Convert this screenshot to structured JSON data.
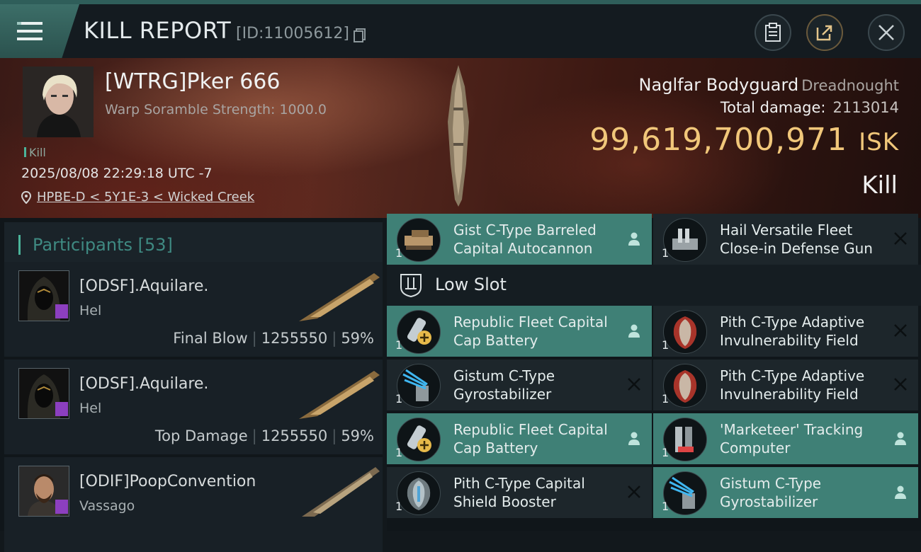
{
  "header": {
    "title": "KILL REPORT",
    "report_id": "[ID:11005612]"
  },
  "victim": {
    "pilot_name": "[WTRG]Pker 666",
    "scramble_strength": "Warp Soramble Strength: 1000.0",
    "kill_tag": "Kill",
    "datetime": "2025/08/08 22:29:18 UTC -7",
    "location": "HPBE-D < 5Y1E-3 < Wicked Creek",
    "ship_name": "Naglfar Bodyguard",
    "ship_class": "Dreadnought",
    "total_damage_label": "Total damage:",
    "total_damage": "2113014",
    "isk_value": "99,619,700,971",
    "isk_unit": "ISK",
    "result": "Kill"
  },
  "participants": {
    "label": "Participants",
    "count": "[53]",
    "items": [
      {
        "name": "[ODSF].Aquilare.",
        "ship": "Hel",
        "role": "Final Blow",
        "damage": "1255550",
        "percent": "59%"
      },
      {
        "name": "[ODSF].Aquilare.",
        "ship": "Hel",
        "role": "Top Damage",
        "damage": "1255550",
        "percent": "59%"
      },
      {
        "name": "[ODIF]PoopConvention",
        "ship": "Vassago",
        "role": "",
        "damage": "",
        "percent": ""
      }
    ]
  },
  "modules": {
    "top_row": [
      {
        "qty": "1",
        "name_l1": "Gist C-Type Barreled",
        "name_l2": "Capital Autocannon",
        "state": "fitted"
      },
      {
        "qty": "1",
        "name_l1": "Hail Versatile Fleet",
        "name_l2": "Close-in Defense Gun",
        "state": "destroyed"
      }
    ],
    "low_slot_label": "Low Slot",
    "low_slot": [
      {
        "qty": "1",
        "name_l1": "Republic Fleet Capital",
        "name_l2": "Cap Battery",
        "state": "fitted"
      },
      {
        "qty": "1",
        "name_l1": "Pith C-Type Adaptive",
        "name_l2": "Invulnerability Field",
        "state": "destroyed"
      },
      {
        "qty": "1",
        "name_l1": "Gistum C-Type",
        "name_l2": "Gyrostabilizer",
        "state": "destroyed"
      },
      {
        "qty": "1",
        "name_l1": "Pith C-Type Adaptive",
        "name_l2": "Invulnerability Field",
        "state": "destroyed"
      },
      {
        "qty": "1",
        "name_l1": "Republic Fleet Capital",
        "name_l2": "Cap Battery",
        "state": "fitted"
      },
      {
        "qty": "1",
        "name_l1": "'Marketeer' Tracking",
        "name_l2": "Computer",
        "state": "fitted"
      },
      {
        "qty": "1",
        "name_l1": "Pith C-Type Capital",
        "name_l2": "Shield Booster",
        "state": "destroyed"
      },
      {
        "qty": "1",
        "name_l1": "Gistum C-Type",
        "name_l2": "Gyrostabilizer",
        "state": "fitted"
      }
    ]
  },
  "colors": {
    "accent": "#4bb49a",
    "fitted_bg": "#3f8076",
    "isk_gold": "#f1c77a"
  }
}
